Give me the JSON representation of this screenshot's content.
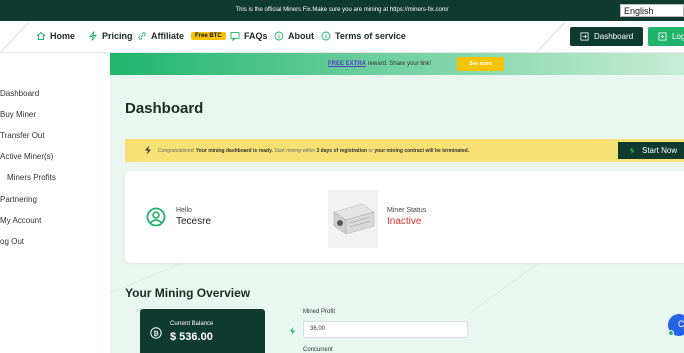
{
  "topbar": {
    "message": "This is the official Miners Fix.Make sure you are mining at https://miners-fix.com/",
    "language": "English"
  },
  "nav": {
    "items": [
      {
        "label": "Home",
        "icon": "home-icon"
      },
      {
        "label": "Pricing",
        "icon": "bolt-icon"
      },
      {
        "label": "Affiliate",
        "icon": "link-icon",
        "badge": "Free BTC"
      },
      {
        "label": "FAQs",
        "icon": "chat-icon"
      },
      {
        "label": "About",
        "icon": "info-icon"
      },
      {
        "label": "Terms of service",
        "icon": "info-icon"
      }
    ],
    "dashboard_button": "Dashboard",
    "login_button": "Log"
  },
  "sidebar": {
    "items": [
      {
        "label": "Dashboard"
      },
      {
        "label": "Buy Miner"
      },
      {
        "label": "Transfer Out"
      },
      {
        "label": "Active Miner(s)"
      },
      {
        "label": "Miners Profits"
      },
      {
        "label": "Partnering"
      },
      {
        "label": "My Account"
      },
      {
        "label": "og Out"
      }
    ]
  },
  "promo": {
    "link": "FREE EXTRA",
    "text": " reward. Share your link!",
    "button": "See more"
  },
  "page": {
    "title": "Dashboard"
  },
  "congrats": {
    "prefix": "Congratulations! ",
    "bold1": "Your mining dashboard is ready.",
    "middle": " Start mining within ",
    "bold2": "3 days of registration",
    "middle2": " or ",
    "bold3": "your mining contract will be terminated.",
    "button": "Start Now"
  },
  "user": {
    "hello": "Hello",
    "name": "Tecesre"
  },
  "miner_status": {
    "label": "Miner Status",
    "value": "Inactive"
  },
  "overview": {
    "title": "Your Mining Overview",
    "balance_label": "Current Balance",
    "balance_value": "$ 536.00",
    "mined_profit_label": "Mined Profit",
    "mined_profit_value": "36.00",
    "concurrent_label": "Concurrent"
  },
  "chat": {
    "label": "C"
  },
  "colors": {
    "dark_green": "#0f3b2e",
    "accent_green": "#1fb36b",
    "yellow": "#f5c400",
    "inactive_red": "#e03030"
  }
}
